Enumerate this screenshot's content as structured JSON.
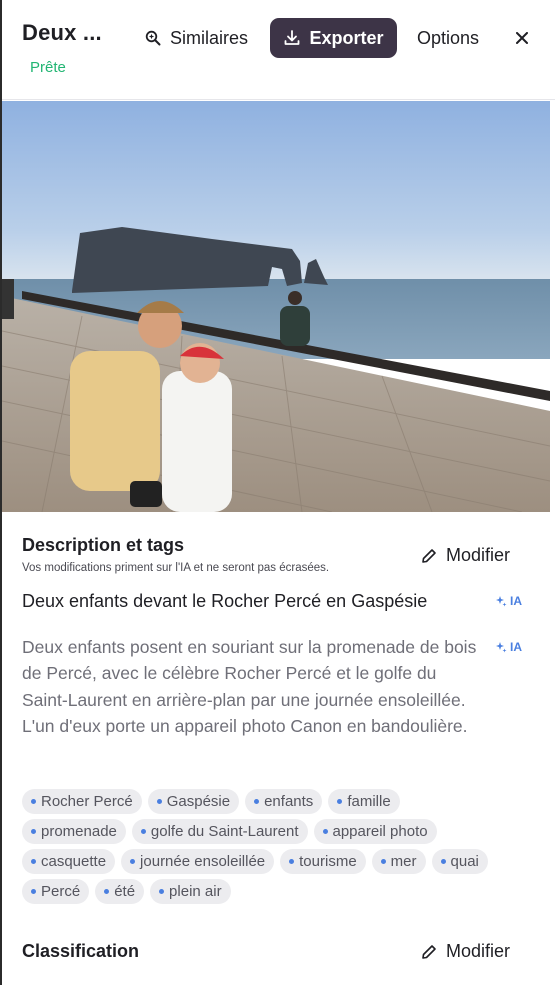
{
  "header": {
    "title": "Deux ...",
    "status": "Prête",
    "similar_label": "Similaires",
    "export_label": "Exporter",
    "options_label": "Options",
    "close_symbol": "×"
  },
  "description_section": {
    "title": "Description et tags",
    "subtitle": "Vos modifications priment sur l'IA et ne seront pas écrasées.",
    "modify_label": "Modifier",
    "caption": "Deux enfants devant le Rocher Percé en Gaspésie",
    "ia_label": "IA",
    "description": "Deux enfants posent en souriant sur la promenade de bois de Percé, avec le célèbre Rocher Percé et le golfe du Saint-Laurent en arrière-plan par une journée ensoleillée. L'un d'eux porte un appareil photo Canon en bandoulière.",
    "tags": [
      [
        "Rocher Percé",
        "Gaspésie",
        "enfants",
        "famille"
      ],
      [
        "promenade",
        "golfe du Saint-Laurent",
        "appareil photo"
      ],
      [
        "casquette",
        "journée ensoleillée",
        "tourisme",
        "mer",
        "quai"
      ],
      [
        "Percé",
        "été",
        "plein air"
      ]
    ]
  },
  "classification_section": {
    "title": "Classification",
    "modify_label": "Modifier"
  },
  "colors": {
    "accent_dark": "#3d3447",
    "status_green": "#22b573",
    "ia_blue": "#4a7fe0"
  },
  "icons": [
    "search-sparkle-icon",
    "download-icon",
    "close-icon",
    "pencil-icon",
    "sparkle-icon"
  ]
}
